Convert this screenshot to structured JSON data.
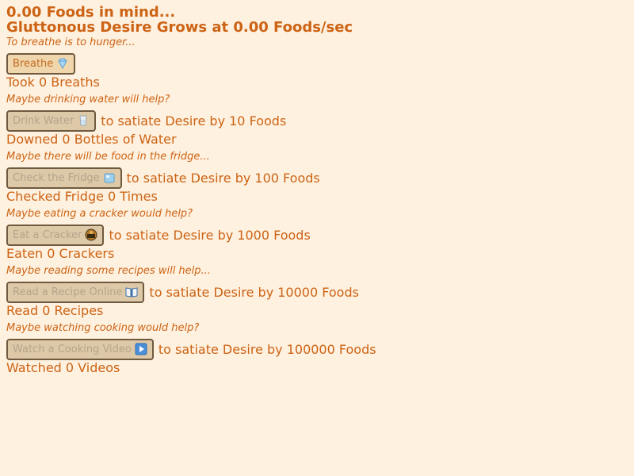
{
  "header": {
    "foods_line": "0.00 Foods in mind...",
    "rate_line": "Gluttonous Desire Grows at 0.00 Foods/sec"
  },
  "sections": [
    {
      "flavor": "To breathe is to hunger...",
      "button_label": "Breathe",
      "button_icon": "gem-icon",
      "after_text": "",
      "count_text": "Took 0 Breaths"
    },
    {
      "flavor": "Maybe drinking water will help?",
      "button_label": "Drink Water",
      "button_icon": "glass-of-water-icon",
      "after_text": "to satiate Desire by 10 Foods",
      "count_text": "Downed 0 Bottles of Water"
    },
    {
      "flavor": "Maybe there will be food in the fridge...",
      "button_label": "Check the Fridge",
      "button_icon": "ice-cube-icon",
      "after_text": "to satiate Desire by 100 Foods",
      "count_text": "Checked Fridge 0 Times"
    },
    {
      "flavor": "Maybe eating a cracker would help?",
      "button_label": "Eat a Cracker",
      "button_icon": "cracker-icon",
      "after_text": "to satiate Desire by 1000 Foods",
      "count_text": "Eaten 0 Crackers"
    },
    {
      "flavor": "Maybe reading some recipes will help...",
      "button_label": "Read a Recipe Online",
      "button_icon": "open-book-icon",
      "after_text": "to satiate Desire by 10000 Foods",
      "count_text": "Read 0 Recipes"
    },
    {
      "flavor": "Maybe watching cooking would help?",
      "button_label": "Watch a Cooking Video",
      "button_icon": "play-button-icon",
      "after_text": "to satiate Desire by 100000 Foods",
      "count_text": "Watched 0 Videos"
    }
  ],
  "colors": {
    "background": "#fff1df",
    "text": "#cc6315",
    "button_bg": "#ddc9a8",
    "button_border": "#6f5a40"
  }
}
